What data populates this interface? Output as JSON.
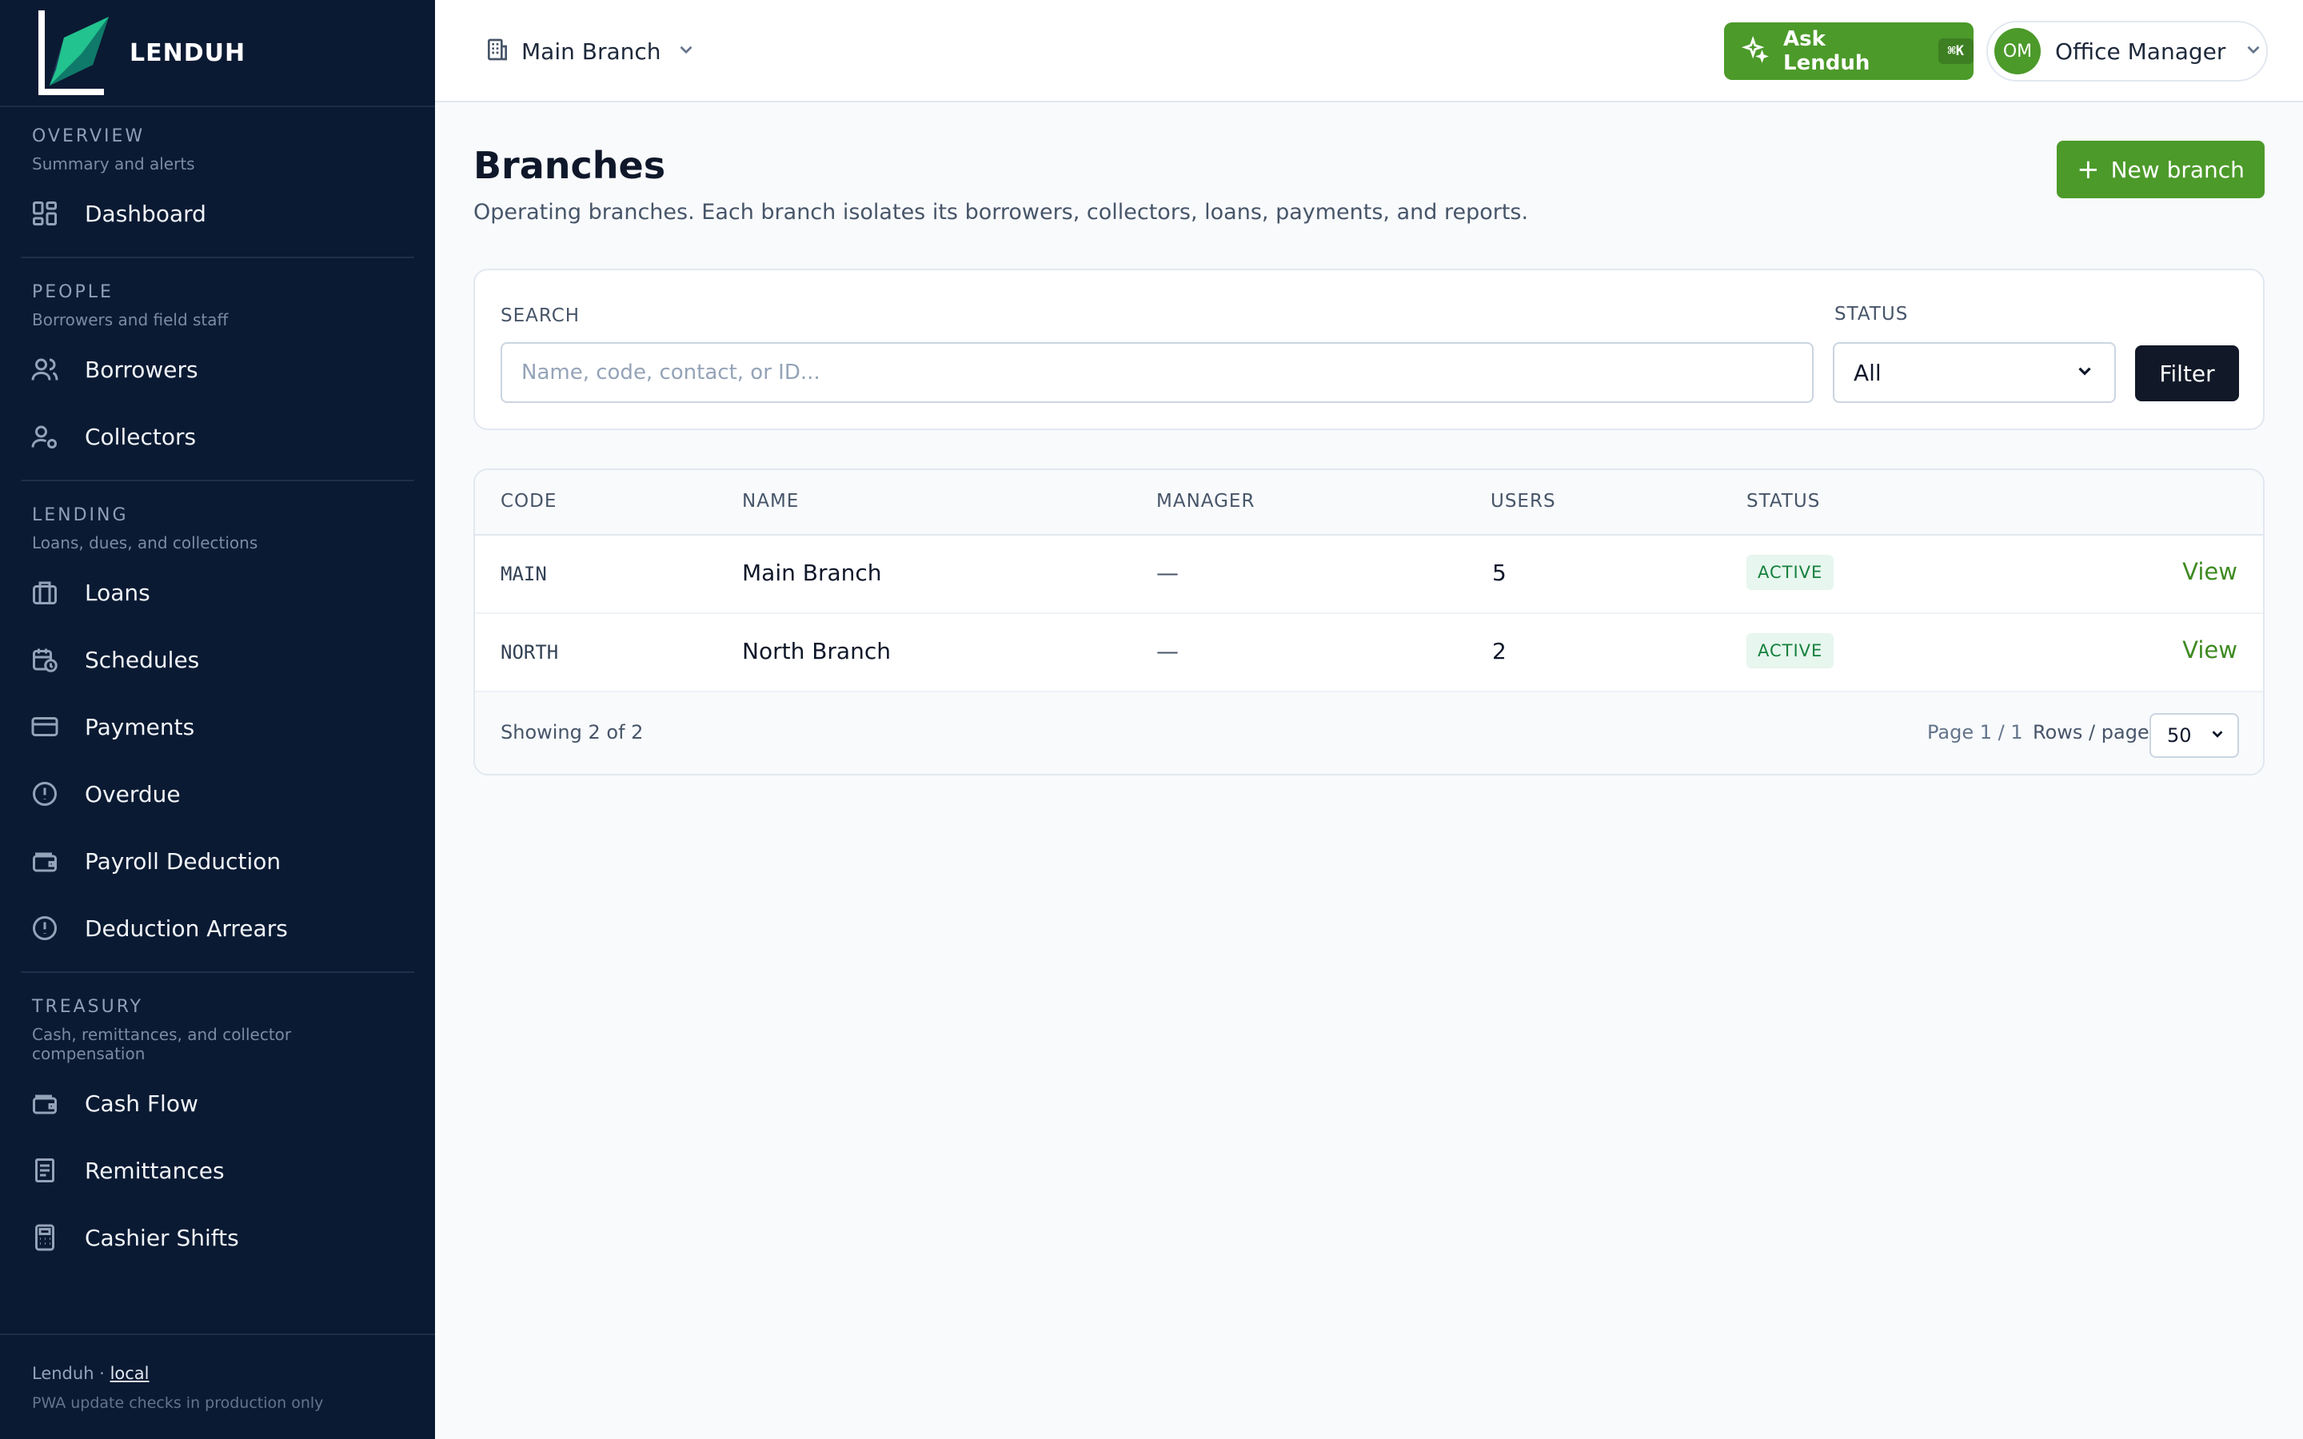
{
  "brand": {
    "name": "LENDUH",
    "accent": "#4c9a2a",
    "sidebar_bg": "#0b1a33"
  },
  "sidebar": {
    "sections": [
      {
        "title": "OVERVIEW",
        "subtitle": "Summary and alerts",
        "items": [
          {
            "label": "Dashboard",
            "icon": "dashboard-icon"
          }
        ]
      },
      {
        "title": "PEOPLE",
        "subtitle": "Borrowers and field staff",
        "items": [
          {
            "label": "Borrowers",
            "icon": "users-icon"
          },
          {
            "label": "Collectors",
            "icon": "user-cog-icon"
          }
        ]
      },
      {
        "title": "LENDING",
        "subtitle": "Loans, dues, and collections",
        "items": [
          {
            "label": "Loans",
            "icon": "briefcase-icon"
          },
          {
            "label": "Schedules",
            "icon": "calendar-clock-icon"
          },
          {
            "label": "Payments",
            "icon": "credit-card-icon"
          },
          {
            "label": "Overdue",
            "icon": "alert-circle-icon"
          },
          {
            "label": "Payroll Deduction",
            "icon": "wallet-icon"
          },
          {
            "label": "Deduction Arrears",
            "icon": "alert-circle-icon"
          }
        ]
      },
      {
        "title": "TREASURY",
        "subtitle": "Cash, remittances, and collector compensation",
        "items": [
          {
            "label": "Cash Flow",
            "icon": "wallet-icon"
          },
          {
            "label": "Remittances",
            "icon": "receipt-icon"
          },
          {
            "label": "Cashier Shifts",
            "icon": "calculator-icon"
          }
        ]
      }
    ],
    "footer": {
      "app": "Lenduh ·",
      "env": "local",
      "note": "PWA update checks in production only"
    }
  },
  "topbar": {
    "branch": "Main Branch",
    "ask_label": "Ask Lenduh",
    "ask_shortcut": "⌘K",
    "user_initials": "OM",
    "user_name": "Office Manager"
  },
  "page": {
    "title": "Branches",
    "subtitle": "Operating branches. Each branch isolates its borrowers, collectors, loans, payments, and reports.",
    "new_button": "New branch"
  },
  "filters": {
    "search_label": "SEARCH",
    "search_placeholder": "Name, code, contact, or ID...",
    "status_label": "STATUS",
    "status_value": "All",
    "filter_button": "Filter"
  },
  "table": {
    "columns": [
      "CODE",
      "NAME",
      "MANAGER",
      "USERS",
      "STATUS"
    ],
    "rows": [
      {
        "code": "MAIN",
        "name": "Main Branch",
        "manager": "—",
        "users": "5",
        "status": "ACTIVE",
        "action": "View"
      },
      {
        "code": "NORTH",
        "name": "North Branch",
        "manager": "—",
        "users": "2",
        "status": "ACTIVE",
        "action": "View"
      }
    ],
    "showing": "Showing 2 of 2",
    "page_info": "Page 1 / 1",
    "rows_label": "Rows / page",
    "rows_value": "50"
  }
}
